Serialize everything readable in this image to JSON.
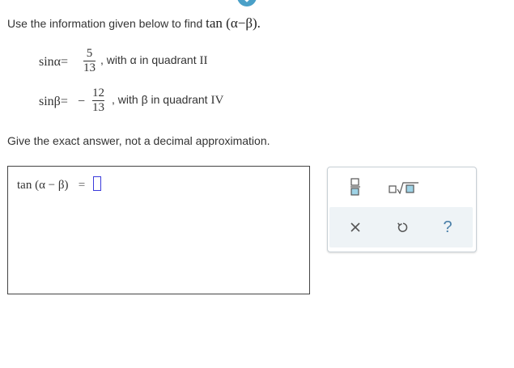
{
  "intro": {
    "text": "Use the information given below to find",
    "expression": "tan (α−β)."
  },
  "given": [
    {
      "lhs": "sinα=",
      "sign": "",
      "numerator": "5",
      "denominator": "13",
      "comma": ",",
      "desc_prefix": "with α in quadrant",
      "quadrant": "II"
    },
    {
      "lhs": "sinβ=",
      "sign": "−",
      "numerator": "12",
      "denominator": "13",
      "comma": ",",
      "desc_prefix": "with β in quadrant",
      "quadrant": "IV"
    }
  ],
  "note": "Give the exact answer, not a decimal approximation.",
  "answer": {
    "lhs": "tan (α − β)",
    "equals": "="
  },
  "palette": {
    "help_label": "?"
  },
  "colors": {
    "accent": "#4a7fa8",
    "slot": "#3b3bdb",
    "chevron": "#4aa0c8"
  }
}
